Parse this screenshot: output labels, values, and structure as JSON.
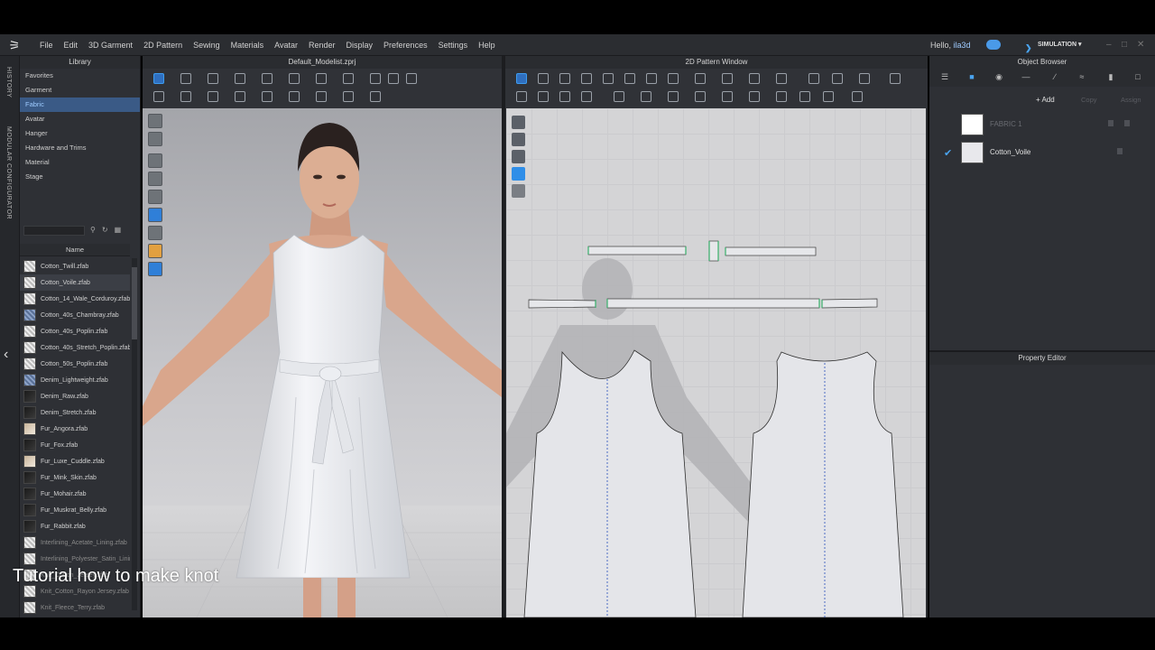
{
  "app": {
    "menu": [
      "File",
      "Edit",
      "3D Garment",
      "2D Pattern",
      "Sewing",
      "Materials",
      "Avatar",
      "Render",
      "Display",
      "Preferences",
      "Settings",
      "Help"
    ],
    "greeting_prefix": "Hello, ",
    "username": "ila3d",
    "mode_label": "SIMULATION"
  },
  "side_strip": {
    "history_label": "HISTORY",
    "modular_label": "MODULAR CONFIGURATOR"
  },
  "library": {
    "title": "Library",
    "tree": [
      "Favorites",
      "Garment",
      "Fabric",
      "Avatar",
      "Hanger",
      "Hardware and Trims",
      "Material",
      "Stage"
    ],
    "selected_tree_item": "Fabric",
    "column_header": "Name",
    "files": [
      {
        "name": "Cotton_Twill.zfab",
        "swatch": "tw"
      },
      {
        "name": "Cotton_Voile.zfab",
        "swatch": "tw",
        "selected": true
      },
      {
        "name": "Cotton_14_Wale_Corduroy.zfab",
        "swatch": "tw"
      },
      {
        "name": "Cotton_40s_Chambray.zfab",
        "swatch": "den"
      },
      {
        "name": "Cotton_40s_Poplin.zfab",
        "swatch": "tw"
      },
      {
        "name": "Cotton_40s_Stretch_Poplin.zfab",
        "swatch": "tw"
      },
      {
        "name": "Cotton_50s_Poplin.zfab",
        "swatch": "tw"
      },
      {
        "name": "Denim_Lightweight.zfab",
        "swatch": "den"
      },
      {
        "name": "Denim_Raw.zfab",
        "swatch": "dk"
      },
      {
        "name": "Denim_Stretch.zfab",
        "swatch": "dk"
      },
      {
        "name": "Fur_Angora.zfab",
        "swatch": "fur"
      },
      {
        "name": "Fur_Fox.zfab",
        "swatch": "dk"
      },
      {
        "name": "Fur_Luxe_Cuddle.zfab",
        "swatch": "fur"
      },
      {
        "name": "Fur_Mink_Skin.zfab",
        "swatch": "dk"
      },
      {
        "name": "Fur_Mohair.zfab",
        "swatch": "dk"
      },
      {
        "name": "Fur_Muskrat_Belly.zfab",
        "swatch": "dk"
      },
      {
        "name": "Fur_Rabbit.zfab",
        "swatch": "dk"
      },
      {
        "name": "Interlining_Acetate_Lining.zfab",
        "swatch": "tw",
        "dim": true
      },
      {
        "name": "Interlining_Polyester_Satin_Lining.zfab",
        "swatch": "tw",
        "dim": true
      },
      {
        "name": "Knit_Cotton_Jersey.zfab",
        "swatch": "tw",
        "dim": true
      },
      {
        "name": "Knit_Cotton_Rayon Jersey.zfab",
        "swatch": "tw",
        "dim": true
      },
      {
        "name": "Knit_Fleece_Terry.zfab",
        "swatch": "tw",
        "dim": true
      }
    ]
  },
  "view3d": {
    "title": "Default_Modelist.zprj"
  },
  "view2d": {
    "title": "2D Pattern Window"
  },
  "object_browser": {
    "title": "Object Browser",
    "add_label": "+ Add",
    "copy_label": "Copy",
    "assign_label": "Assign",
    "items": [
      {
        "name": "FABRIC 1",
        "active": false
      },
      {
        "name": "Cotton_Voile",
        "active": true
      }
    ]
  },
  "property_editor": {
    "title": "Property Editor"
  },
  "caption": "Tutorial how to make knot",
  "colors": {
    "accent": "#3d9cf0",
    "panel": "#2e3035",
    "selected_row": "#3a5a86",
    "dress": "#eeeff2",
    "skin": "#d9a68c"
  }
}
